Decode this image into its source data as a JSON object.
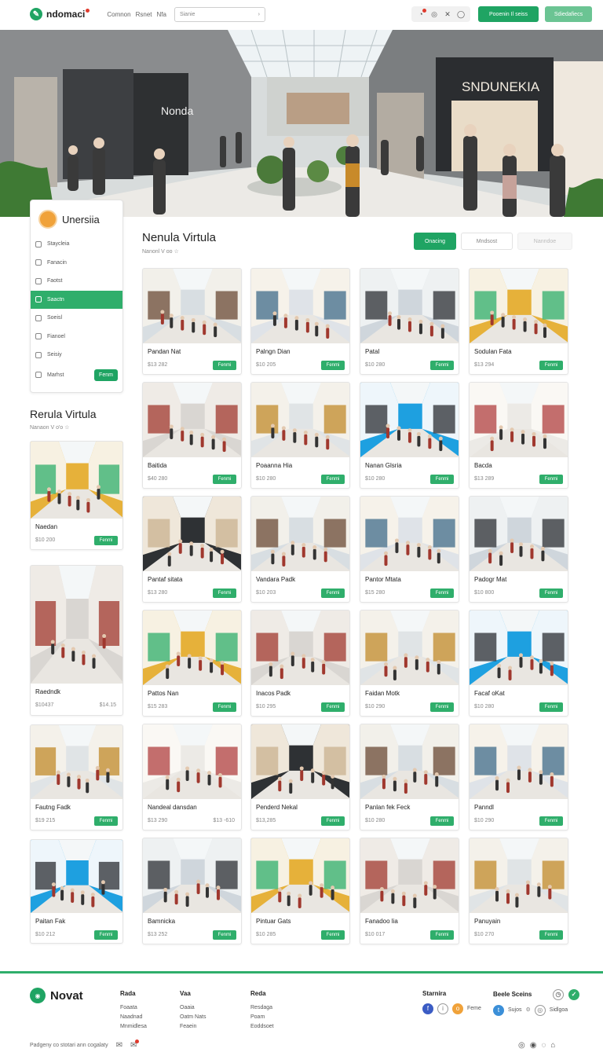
{
  "header": {
    "brand": "ndomaci",
    "nav": [
      "Comnon",
      "Rsnet",
      "Nfa"
    ],
    "search_placeholder": "Sianie",
    "primary_button": "Pooenin Il seiss",
    "secondary_button": "Sdiedafiecs"
  },
  "sidebar": {
    "title": "Unersiia",
    "items": [
      {
        "label": "Staycleia",
        "active": false
      },
      {
        "label": "Fanacin",
        "active": false
      },
      {
        "label": "Faotst",
        "active": false
      },
      {
        "label": "Saactn",
        "active": true
      },
      {
        "label": "Soeisl",
        "active": false
      },
      {
        "label": "Fianoel",
        "active": false
      },
      {
        "label": "Seisiy",
        "active": false
      }
    ],
    "footer_label": "Marhst",
    "footer_button": "Fenm"
  },
  "main": {
    "title": "Nenula Virtula",
    "subtitle": "Nanonl V oo ☆",
    "tabs": [
      "Onacing",
      "Mndsost",
      "Nanndoe"
    ],
    "side_title": "Rerula Virtula",
    "side_subtitle": "Nanaon V o'o ☆",
    "card_button": "Fenmi"
  },
  "side_cards": [
    {
      "name": "Naedan",
      "price": "$10 200"
    },
    {
      "name": "Raedndk",
      "price": "$10437",
      "price2": "$14.15"
    },
    {
      "name": "Fautng Fadk",
      "price": "$19 215"
    },
    {
      "name": "Paitan Fak",
      "price": "$10 212"
    }
  ],
  "grid_cards": [
    {
      "name": "Pandan Nat",
      "price": "$13 282"
    },
    {
      "name": "Palngn Dian",
      "price": "$10 205"
    },
    {
      "name": "Patal",
      "price": "$10 280"
    },
    {
      "name": "Sodulan Fata",
      "price": "$13 294"
    },
    {
      "name": "Baitida",
      "price": "$40 280"
    },
    {
      "name": "Poaanna Hia",
      "price": "$10 280"
    },
    {
      "name": "Nanan Glsria",
      "price": "$10 280"
    },
    {
      "name": "Bacda",
      "price": "$13 289"
    },
    {
      "name": "Pantaf sitata",
      "price": "$13 280"
    },
    {
      "name": "Vandara Padk",
      "price": "$10 203"
    },
    {
      "name": "Pantor Mtata",
      "price": "$15 280"
    },
    {
      "name": "Padogr Mat",
      "price": "$10 800"
    },
    {
      "name": "Pattos Nan",
      "price": "$15 283"
    },
    {
      "name": "Inacos Padk",
      "price": "$10 295"
    },
    {
      "name": "Faidan Motk",
      "price": "$10 290"
    },
    {
      "name": "Facaf oKat",
      "price": "$10 280"
    },
    {
      "name": "Nandeal dansdan",
      "price": "$13 290",
      "price2": "$13 -610"
    },
    {
      "name": "Penderd Nekal",
      "price": "$13,285"
    },
    {
      "name": "Panlan fek Feck",
      "price": "$10 280"
    },
    {
      "name": "Panndl",
      "price": "$10 290"
    },
    {
      "name": "Bamnicka",
      "price": "$13 252"
    },
    {
      "name": "Pintuar Gats",
      "price": "$10 285"
    },
    {
      "name": "Fanadoo lia",
      "price": "$10 017"
    },
    {
      "name": "Panuyain",
      "price": "$10 270"
    }
  ],
  "footer": {
    "brand": "Novat",
    "cols": [
      {
        "title": "Rada",
        "links": [
          "Foaata",
          "Naadnad",
          "Mnmidlesa"
        ]
      },
      {
        "title": "Vaa",
        "links": [
          "Oaaia",
          "Oatm Nats",
          "Feaein"
        ]
      },
      {
        "title": "Reda",
        "links": [
          "Resdaga",
          "Poam",
          "Eoddsoet"
        ]
      }
    ],
    "social_title": "Starnira",
    "social_label": "Feme",
    "right_title": "Beele Sceins",
    "right_label": "Sujos",
    "right_label2": "Sidlgoa",
    "copyright": "Padgeny co stotari ann cogalaty"
  },
  "colors": {
    "accent": "#1fa463",
    "accent_light": "#6bc493",
    "danger": "#e03b2e"
  }
}
